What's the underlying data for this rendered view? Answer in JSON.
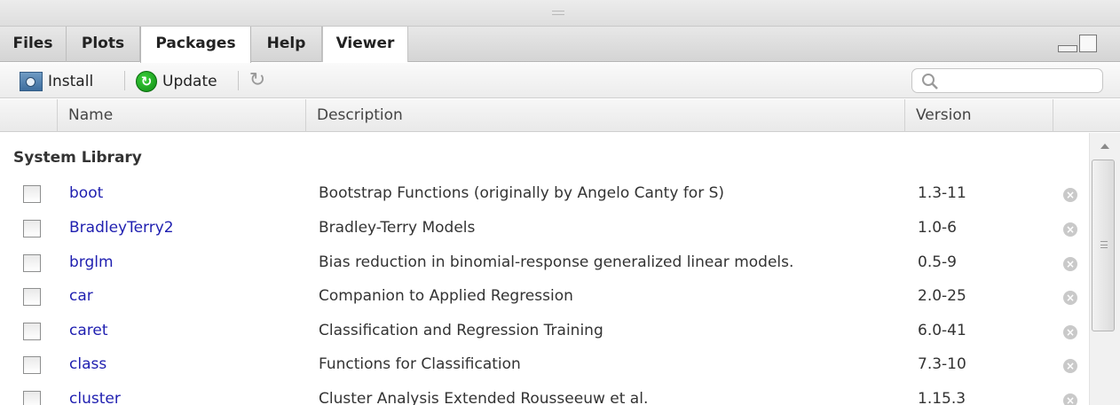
{
  "tabs": [
    {
      "label": "Files"
    },
    {
      "label": "Plots"
    },
    {
      "label": "Packages",
      "active": true
    },
    {
      "label": "Help"
    },
    {
      "label": "Viewer"
    }
  ],
  "toolbar": {
    "install_label": "Install",
    "update_label": "Update",
    "search_placeholder": ""
  },
  "table": {
    "columns": [
      "Name",
      "Description",
      "Version"
    ]
  },
  "section_title": "System Library",
  "packages": [
    {
      "name": "boot",
      "description": "Bootstrap Functions (originally by Angelo Canty for S)",
      "version": "1.3-11"
    },
    {
      "name": "BradleyTerry2",
      "description": "Bradley-Terry Models",
      "version": "1.0-6"
    },
    {
      "name": "brglm",
      "description": "Bias reduction in binomial-response generalized linear models.",
      "version": "0.5-9"
    },
    {
      "name": "car",
      "description": "Companion to Applied Regression",
      "version": "2.0-25"
    },
    {
      "name": "caret",
      "description": "Classification and Regression Training",
      "version": "6.0-41"
    },
    {
      "name": "class",
      "description": "Functions for Classification",
      "version": "7.3-10"
    },
    {
      "name": "cluster",
      "description": "Cluster Analysis Extended Rousseeuw et al.",
      "version": "1.15.3"
    }
  ],
  "colors": {
    "package_link": "#1f1fb0",
    "update_icon": "#18a01c",
    "install_icon": "#4a79a8"
  },
  "icons": {
    "install": "install-package-icon",
    "update": "update-icon",
    "refresh": "refresh-icon",
    "search": "search-icon",
    "remove": "remove-circle-icon",
    "minimize": "minimize-icon",
    "maximize": "maximize-icon"
  }
}
